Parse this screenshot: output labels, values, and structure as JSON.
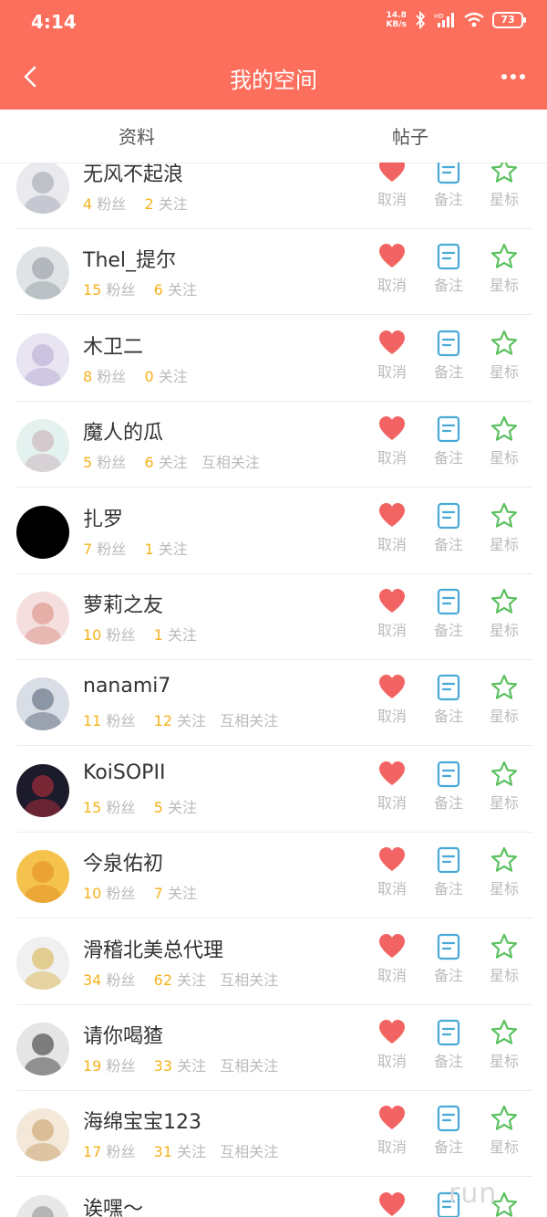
{
  "status_bar": {
    "time": "4:14",
    "speed_value": "14.8",
    "speed_unit": "KB/s",
    "battery": "73"
  },
  "app_bar": {
    "title": "我的空间",
    "back_icon": "back-arrow-icon",
    "more_icon": "more-icon"
  },
  "tabs": [
    {
      "label": "资料"
    },
    {
      "label": "帖子"
    }
  ],
  "labels": {
    "fans": "粉丝",
    "follows": "关注",
    "cancel": "取消",
    "note": "备注",
    "star": "星标"
  },
  "users": [
    {
      "name": "无风不起浪",
      "fans": "4",
      "follows": "2",
      "mutual": ""
    },
    {
      "name": "Thel_提尔",
      "fans": "15",
      "follows": "6",
      "mutual": ""
    },
    {
      "name": "木卫二",
      "fans": "8",
      "follows": "0",
      "mutual": ""
    },
    {
      "name": "魔人的瓜",
      "fans": "5",
      "follows": "6",
      "mutual": "互相关注"
    },
    {
      "name": "扎罗",
      "fans": "7",
      "follows": "1",
      "mutual": ""
    },
    {
      "name": "萝莉之友",
      "fans": "10",
      "follows": "1",
      "mutual": ""
    },
    {
      "name": "nanami7",
      "fans": "11",
      "follows": "12",
      "mutual": "互相关注"
    },
    {
      "name": "KoiSOPII",
      "fans": "15",
      "follows": "5",
      "mutual": ""
    },
    {
      "name": "今泉佑初",
      "fans": "10",
      "follows": "7",
      "mutual": ""
    },
    {
      "name": "滑稽北美总代理",
      "fans": "34",
      "follows": "62",
      "mutual": "互相关注"
    },
    {
      "name": "请你喝猹",
      "fans": "19",
      "follows": "33",
      "mutual": "互相关注"
    },
    {
      "name": "海绵宝宝123",
      "fans": "17",
      "follows": "31",
      "mutual": "互相关注"
    },
    {
      "name": "诶嘿～",
      "fans": "",
      "follows": "",
      "mutual": ""
    }
  ],
  "watermark": "run",
  "colors": {
    "header": "#fd6f5d",
    "number": "#f5b21c",
    "heart": "#f26463",
    "note": "#48a9d6",
    "star": "#5cc15f"
  }
}
